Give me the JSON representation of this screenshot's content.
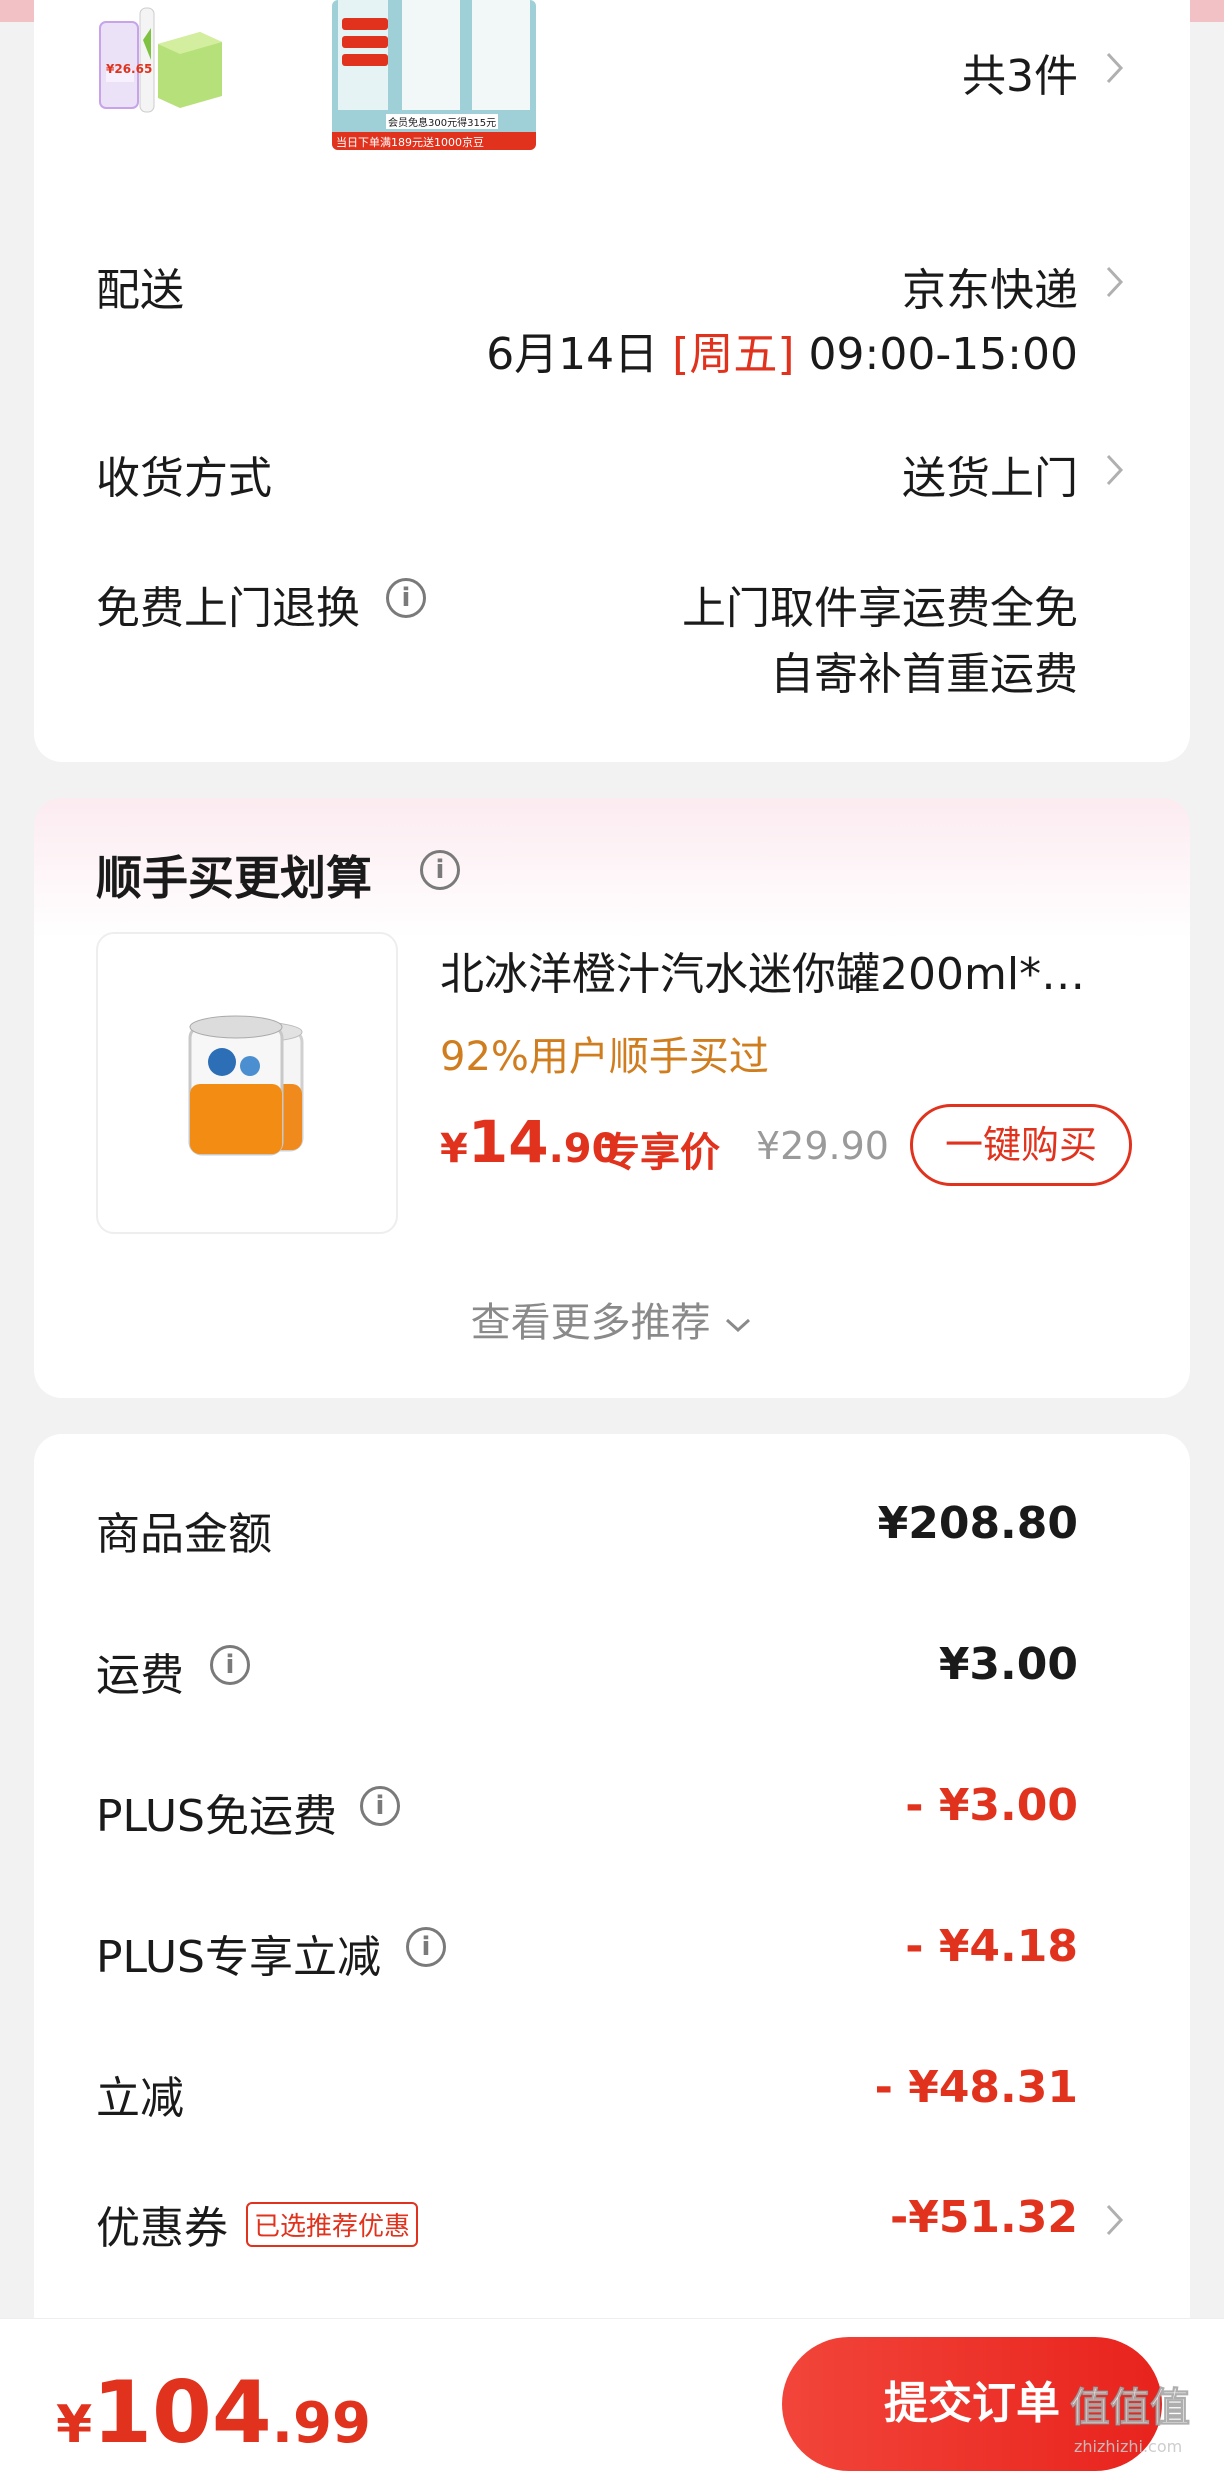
{
  "order": {
    "thumb1": {
      "price_tag": "¥26.65"
    },
    "thumb2": {
      "banner": "会员免息300元得315元",
      "footer": "当日下单满189元送1000京豆"
    },
    "item_count": "共3件",
    "delivery": {
      "label": "配送",
      "carrier": "京东快递",
      "date": "6月14日",
      "weekday": "[周五]",
      "time": "09:00-15:00"
    },
    "receive": {
      "label": "收货方式",
      "value": "送货上门"
    },
    "free_return": {
      "label": "免费上门退换",
      "line1": "上门取件享运费全免",
      "line2": "自寄补首重运费"
    }
  },
  "reco": {
    "title": "顺手买更划算",
    "product_name": "北冰洋橙汁汽水迷你罐200ml*…",
    "sub": "92%用户顺手买过",
    "price_currency": "¥",
    "price_int": "14",
    "price_dec": ".90",
    "price_tag": "专享价",
    "original_price": "¥29.90",
    "buy_label": "一键购买",
    "more": "查看更多推荐"
  },
  "amounts": [
    {
      "label": "商品金额",
      "value": "¥208.80",
      "tone": "black",
      "info": false
    },
    {
      "label": "运费",
      "value": "¥3.00",
      "tone": "black",
      "info": true
    },
    {
      "label": "PLUS免运费",
      "value": "- ¥3.00",
      "tone": "red",
      "info": true
    },
    {
      "label": "PLUS专享立减",
      "value": "- ¥4.18",
      "tone": "red",
      "info": true
    },
    {
      "label": "立减",
      "value": "- ¥48.31",
      "tone": "red",
      "info": false
    },
    {
      "label": "优惠券",
      "value": "-¥51.32",
      "tone": "red",
      "info": false,
      "tag": "已选推荐优惠"
    }
  ],
  "footer": {
    "currency": "¥",
    "total_int": "104",
    "total_dec": ".99",
    "submit_label": "提交订单",
    "watermark": "值值值",
    "watermark_url": "zhizhizhi.com"
  },
  "colors": {
    "accent": "#e0321d",
    "orange": "#d07d1f",
    "bg": "#f2f2f2"
  },
  "icons": [
    "info-icon",
    "chevron-right-icon",
    "chevron-down-icon"
  ]
}
